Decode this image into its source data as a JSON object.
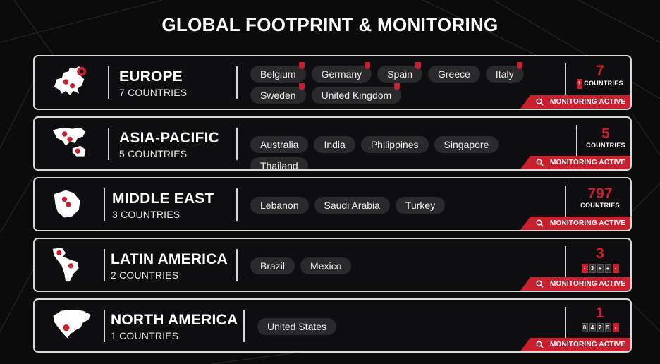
{
  "title": "GLOBAL FOOTPRINT & MONITORING",
  "accent_color": "#c8202f",
  "badge_label": "MONITORING ACTIVE",
  "badge_icon": "magnifier-icon",
  "regions": [
    {
      "name": "EUROPE",
      "count_label": "7 COUNTRIES",
      "map_icon": "europe-map-icon",
      "countries": [
        "Belgium",
        "Germany",
        "Spain",
        "Greece",
        "Italy",
        "Sweden",
        "United Kingdom"
      ],
      "flagged": [
        "Belgium",
        "Germany",
        "Spain",
        "Italy",
        "Sweden",
        "United Kingdom"
      ],
      "stat_number": "7",
      "stat_label": "COUNTRIES",
      "stat_prefix": "1"
    },
    {
      "name": "ASIA-PACIFIC",
      "count_label": "5 COUNTRIES",
      "map_icon": "asia-pacific-map-icon",
      "countries": [
        "Australia",
        "India",
        "Philippines",
        "Singapore",
        "Thailand"
      ],
      "stat_number": "5",
      "stat_label": "COUNTRIES"
    },
    {
      "name": "MIDDLE EAST",
      "count_label": "3 COUNTRIES",
      "map_icon": "middle-east-map-icon",
      "countries": [
        "Lebanon",
        "Saudi Arabia",
        "Turkey"
      ],
      "stat_number": "797",
      "stat_label": "COUNTRIES"
    },
    {
      "name": "LATIN AMERICA",
      "count_label": "2 COUNTRIES",
      "map_icon": "latin-america-map-icon",
      "countries": [
        "Brazil",
        "Mexico"
      ],
      "stat_number": "3",
      "stat_digits": [
        "-",
        "3",
        "+",
        "+",
        "-"
      ]
    },
    {
      "name": "NORTH AMERICA",
      "count_label": "1 COUNTRIES",
      "map_icon": "north-america-map-icon",
      "countries": [
        "United States"
      ],
      "stat_number": "1",
      "stat_digits": [
        "0",
        "4",
        "7",
        "5",
        "-"
      ]
    }
  ]
}
